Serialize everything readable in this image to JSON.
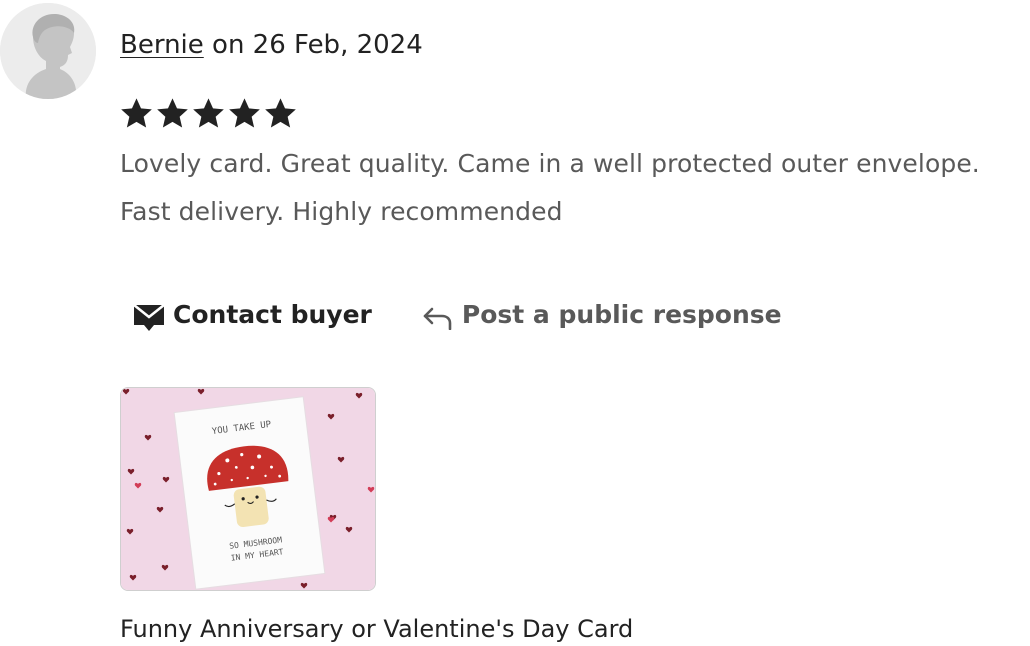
{
  "reviewer": {
    "name": "Bernie",
    "date_text": " on 26 Feb, 2024",
    "avatar_icon": "default-person-avatar"
  },
  "rating": {
    "value": 5,
    "max": 5,
    "star_color": "#222222"
  },
  "review": {
    "line1": "Lovely card. Great quality. Came in a well protected outer envelope.",
    "line2": "Fast delivery. Highly recommended"
  },
  "actions": {
    "contact_label": "Contact buyer",
    "contact_icon": "envelope-icon",
    "public_label": "Post a public response",
    "public_icon": "reply-arrow-icon"
  },
  "product": {
    "title": "Funny Anniversary or Valentine's Day Card",
    "card_text_top": "YOU TAKE UP",
    "card_text_bottom_1": "SO MUSHROOM",
    "card_text_bottom_2": "IN MY HEART",
    "colors": {
      "background": "#f1d7e6",
      "mushroom_cap": "#c7302b",
      "hearts": "#7a1f2b"
    }
  }
}
